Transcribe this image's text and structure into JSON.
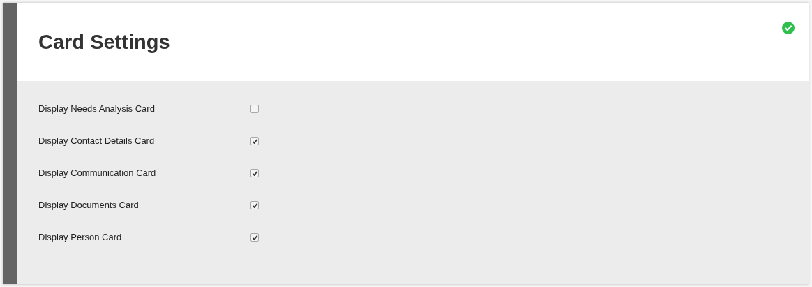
{
  "title": "Card Settings",
  "status": {
    "saved": true
  },
  "settings": [
    {
      "label": "Display Needs Analysis Card",
      "checked": false
    },
    {
      "label": "Display Contact Details Card",
      "checked": true
    },
    {
      "label": "Display Communication Card",
      "checked": true
    },
    {
      "label": "Display Documents Card",
      "checked": true
    },
    {
      "label": "Display Person Card",
      "checked": true
    }
  ]
}
